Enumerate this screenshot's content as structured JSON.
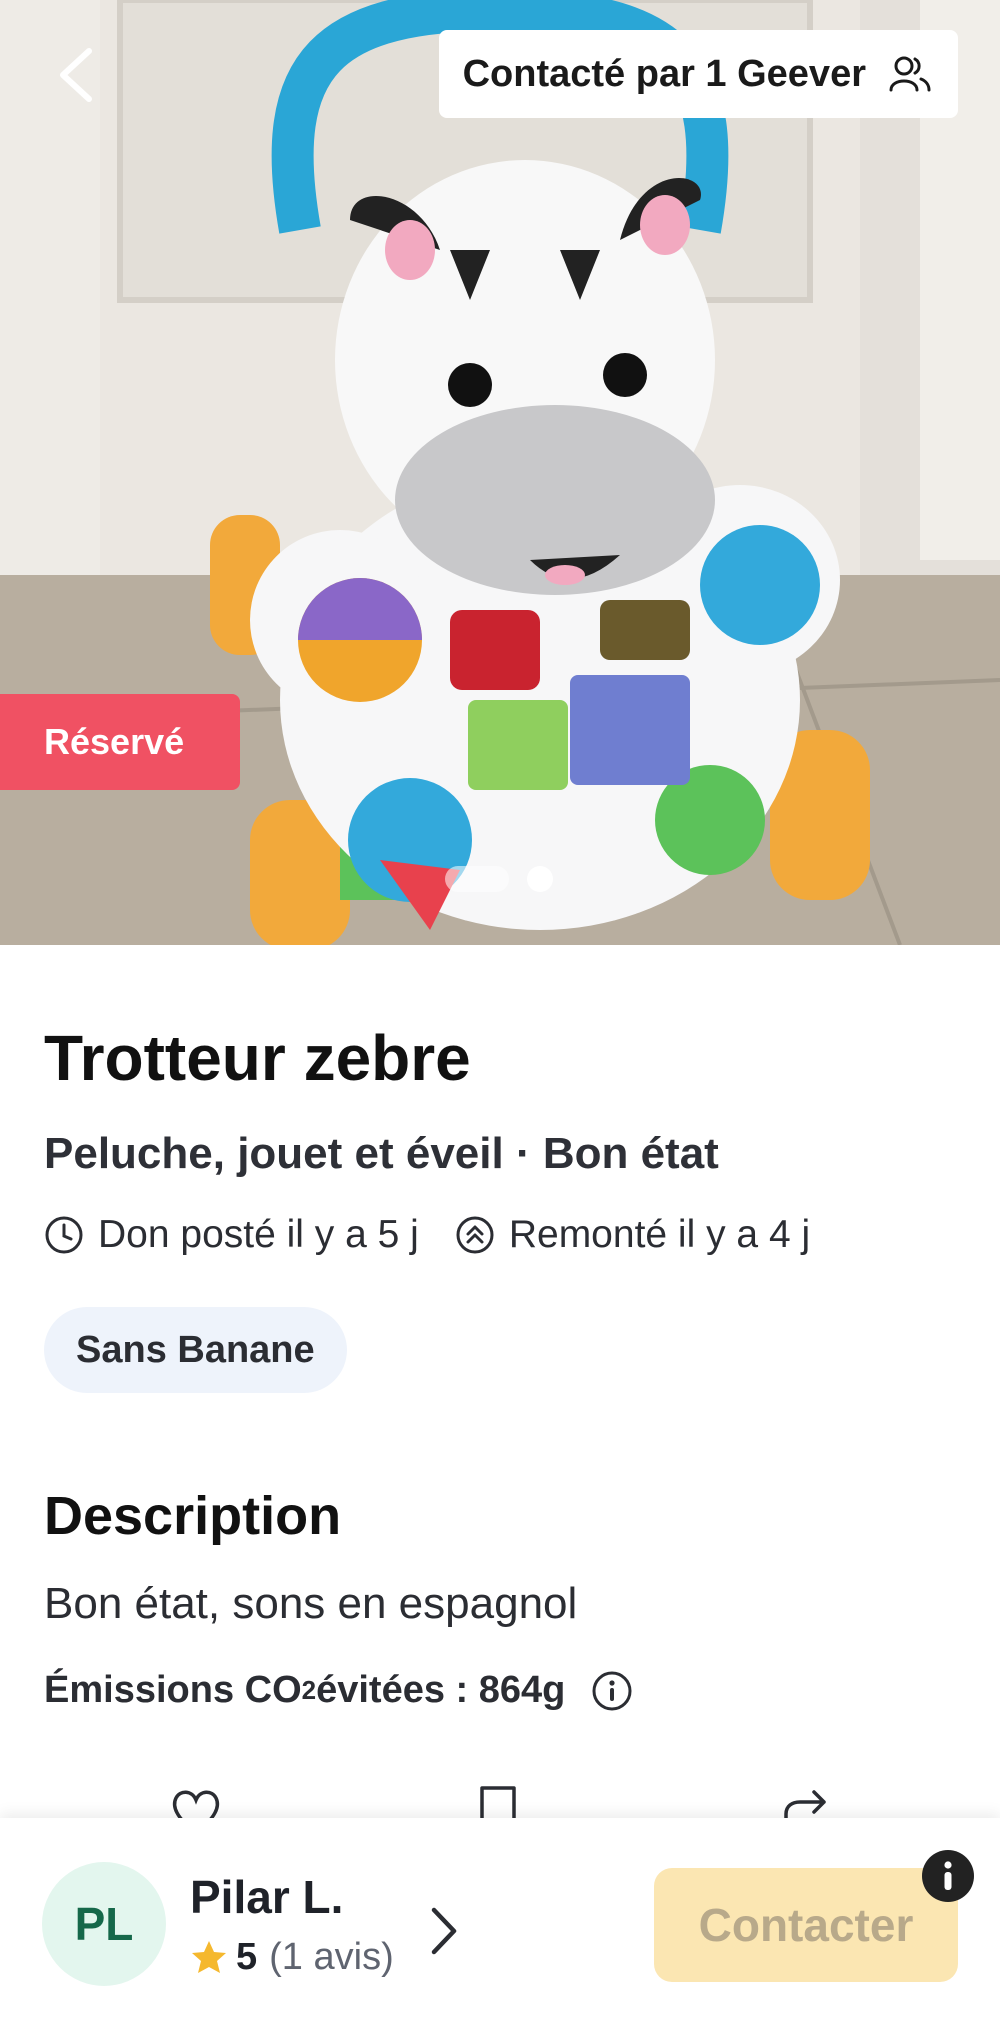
{
  "hero": {
    "contacted_label": "Contacté par 1 Geever",
    "reserved_label": "Réservé",
    "image_count": 2,
    "active_image": 1
  },
  "item": {
    "title": "Trotteur zebre",
    "subtitle": "Peluche, jouet et éveil · Bon état",
    "posted": "Don posté il y a 5 j",
    "bumped": "Remonté il y a 4 j",
    "tag": "Sans Banane"
  },
  "description": {
    "heading": "Description",
    "text": "Bon état,  sons en espagnol",
    "co2_label": "Émissions CO",
    "co2_sub": "2",
    "co2_value": " évitées : 864g"
  },
  "actions": [
    {
      "icon": "heart-icon"
    },
    {
      "icon": "bookmark-icon"
    },
    {
      "icon": "share-icon"
    }
  ],
  "user": {
    "initials": "PL",
    "name": "Pilar L.",
    "rating": "5",
    "reviews": "(1 avis)"
  },
  "cta": {
    "contact_label": "Contacter"
  },
  "colors": {
    "reserved": "#f05163",
    "contact_button": "#fbe6b2",
    "avatar_bg": "#e3f6ee",
    "avatar_text": "#16684a",
    "tag_bg": "#eef3fb",
    "star": "#f5b82e"
  }
}
